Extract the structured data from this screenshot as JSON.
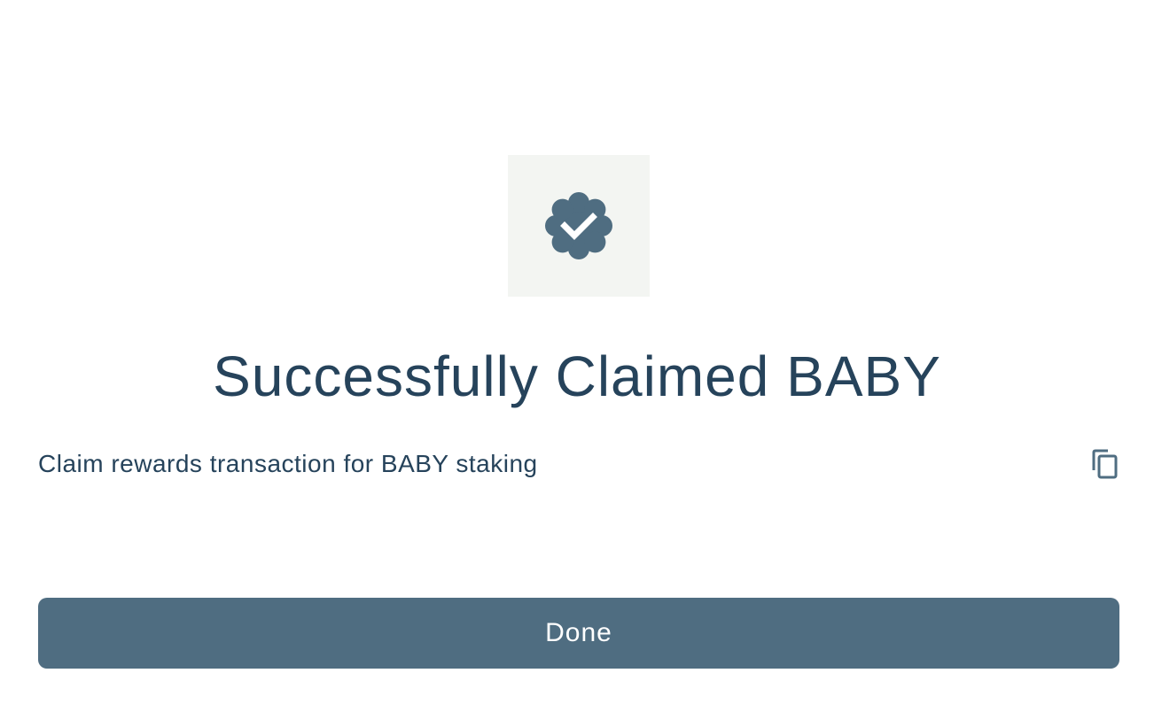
{
  "success": {
    "icon": "verified-badge-check-icon",
    "title": "Successfully Claimed BABY"
  },
  "transaction": {
    "description": "Claim rewards transaction for BABY staking",
    "copy_icon": "copy-icon"
  },
  "actions": {
    "done_label": "Done"
  },
  "colors": {
    "primary": "#4f6d81",
    "text": "#26435b",
    "icon_bg": "#f3f5f2"
  }
}
